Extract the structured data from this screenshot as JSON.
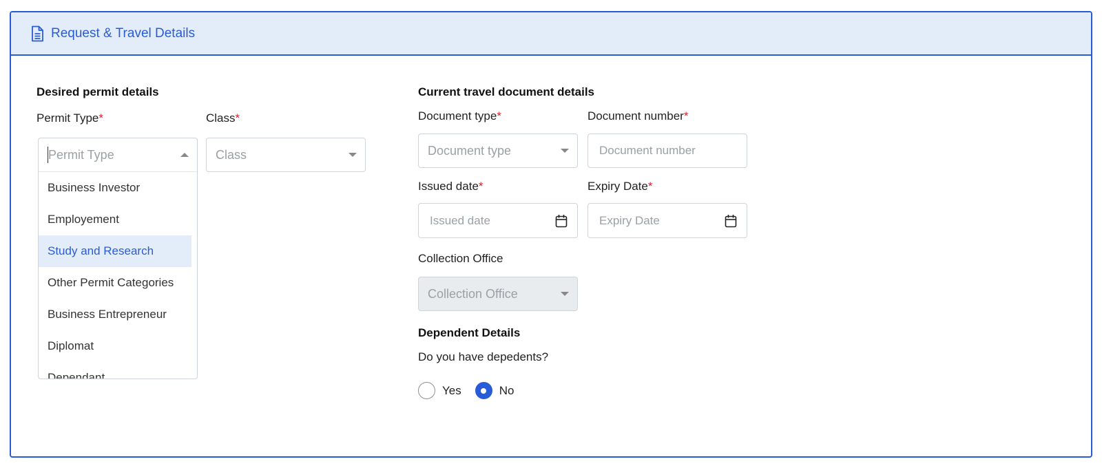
{
  "header": {
    "title": "Request & Travel Details",
    "icon": "document-icon",
    "accent": "#2a5bd7",
    "background": "#e3edf9"
  },
  "permit_section": {
    "title": "Desired permit details",
    "permit_type_label": "Permit Type",
    "permit_type_placeholder": "Permit Type",
    "class_label": "Class",
    "class_placeholder": "Class",
    "required_mark": "*",
    "options": [
      "Business Investor",
      "Employement",
      "Study and Research",
      "Other Permit Categories",
      "Business Entrepreneur",
      "Diplomat",
      "Dependant"
    ],
    "highlighted_option": "Study and Research"
  },
  "travel_section": {
    "title": "Current travel document details",
    "document_type_label": "Document type",
    "document_type_placeholder": "Document type",
    "document_number_label": "Document number",
    "document_number_placeholder": "Document number",
    "issued_date_label": "Issued date",
    "issued_date_placeholder": "Issued date",
    "expiry_date_label": "Expiry Date",
    "expiry_date_placeholder": "Expiry Date",
    "collection_office_label": "Collection Office",
    "collection_office_placeholder": "Collection Office"
  },
  "dependent_section": {
    "title": "Dependent Details",
    "question": "Do you have depedents?",
    "options": [
      "Yes",
      "No"
    ],
    "selected": "No"
  }
}
